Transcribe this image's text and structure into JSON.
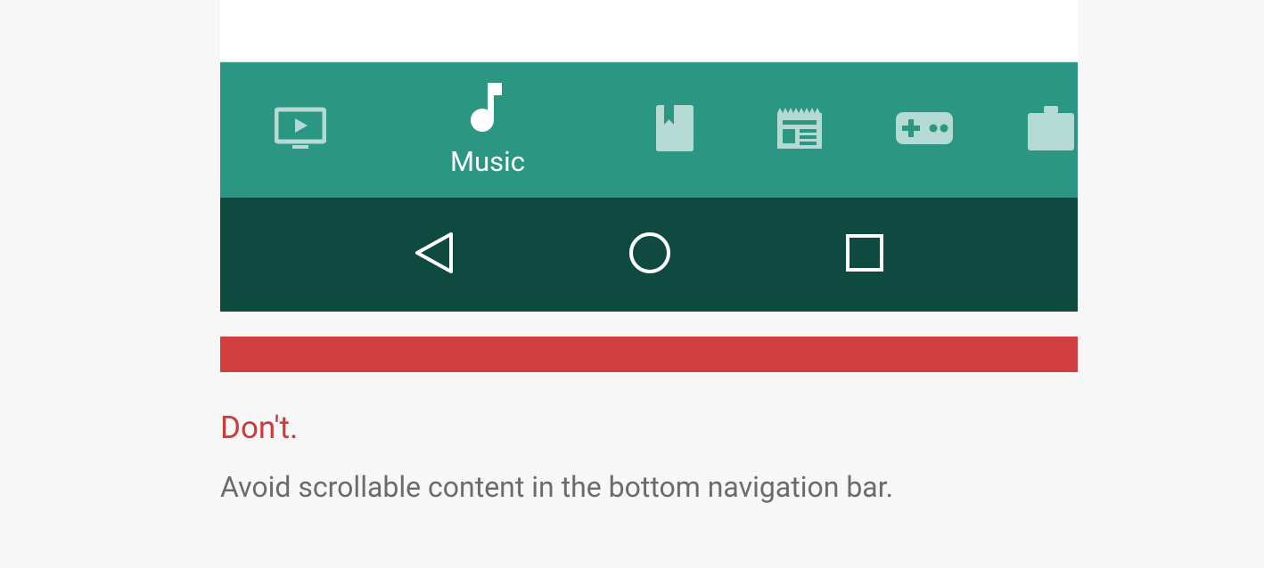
{
  "nav": {
    "items": [
      {
        "name": "video",
        "label": ""
      },
      {
        "name": "music",
        "label": "Music"
      },
      {
        "name": "books",
        "label": ""
      },
      {
        "name": "news",
        "label": ""
      },
      {
        "name": "games",
        "label": ""
      },
      {
        "name": "shop",
        "label": ""
      }
    ]
  },
  "caption": {
    "label": "Don't.",
    "text": "Avoid scrollable content in the bottom navigation bar."
  }
}
